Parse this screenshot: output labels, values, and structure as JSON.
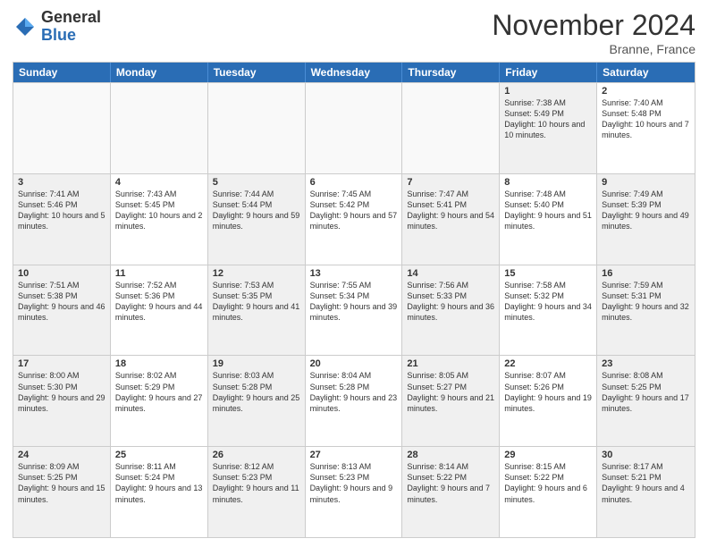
{
  "header": {
    "logo_general": "General",
    "logo_blue": "Blue",
    "title": "November 2024",
    "location": "Branne, France"
  },
  "days_of_week": [
    "Sunday",
    "Monday",
    "Tuesday",
    "Wednesday",
    "Thursday",
    "Friday",
    "Saturday"
  ],
  "weeks": [
    [
      {
        "day": "",
        "info": "",
        "empty": true
      },
      {
        "day": "",
        "info": "",
        "empty": true
      },
      {
        "day": "",
        "info": "",
        "empty": true
      },
      {
        "day": "",
        "info": "",
        "empty": true
      },
      {
        "day": "",
        "info": "",
        "empty": true
      },
      {
        "day": "1",
        "info": "Sunrise: 7:38 AM\nSunset: 5:49 PM\nDaylight: 10 hours and 10 minutes.",
        "shaded": true
      },
      {
        "day": "2",
        "info": "Sunrise: 7:40 AM\nSunset: 5:48 PM\nDaylight: 10 hours and 7 minutes.",
        "shaded": false
      }
    ],
    [
      {
        "day": "3",
        "info": "Sunrise: 7:41 AM\nSunset: 5:46 PM\nDaylight: 10 hours and 5 minutes.",
        "shaded": true
      },
      {
        "day": "4",
        "info": "Sunrise: 7:43 AM\nSunset: 5:45 PM\nDaylight: 10 hours and 2 minutes.",
        "shaded": false
      },
      {
        "day": "5",
        "info": "Sunrise: 7:44 AM\nSunset: 5:44 PM\nDaylight: 9 hours and 59 minutes.",
        "shaded": true
      },
      {
        "day": "6",
        "info": "Sunrise: 7:45 AM\nSunset: 5:42 PM\nDaylight: 9 hours and 57 minutes.",
        "shaded": false
      },
      {
        "day": "7",
        "info": "Sunrise: 7:47 AM\nSunset: 5:41 PM\nDaylight: 9 hours and 54 minutes.",
        "shaded": true
      },
      {
        "day": "8",
        "info": "Sunrise: 7:48 AM\nSunset: 5:40 PM\nDaylight: 9 hours and 51 minutes.",
        "shaded": false
      },
      {
        "day": "9",
        "info": "Sunrise: 7:49 AM\nSunset: 5:39 PM\nDaylight: 9 hours and 49 minutes.",
        "shaded": true
      }
    ],
    [
      {
        "day": "10",
        "info": "Sunrise: 7:51 AM\nSunset: 5:38 PM\nDaylight: 9 hours and 46 minutes.",
        "shaded": true
      },
      {
        "day": "11",
        "info": "Sunrise: 7:52 AM\nSunset: 5:36 PM\nDaylight: 9 hours and 44 minutes.",
        "shaded": false
      },
      {
        "day": "12",
        "info": "Sunrise: 7:53 AM\nSunset: 5:35 PM\nDaylight: 9 hours and 41 minutes.",
        "shaded": true
      },
      {
        "day": "13",
        "info": "Sunrise: 7:55 AM\nSunset: 5:34 PM\nDaylight: 9 hours and 39 minutes.",
        "shaded": false
      },
      {
        "day": "14",
        "info": "Sunrise: 7:56 AM\nSunset: 5:33 PM\nDaylight: 9 hours and 36 minutes.",
        "shaded": true
      },
      {
        "day": "15",
        "info": "Sunrise: 7:58 AM\nSunset: 5:32 PM\nDaylight: 9 hours and 34 minutes.",
        "shaded": false
      },
      {
        "day": "16",
        "info": "Sunrise: 7:59 AM\nSunset: 5:31 PM\nDaylight: 9 hours and 32 minutes.",
        "shaded": true
      }
    ],
    [
      {
        "day": "17",
        "info": "Sunrise: 8:00 AM\nSunset: 5:30 PM\nDaylight: 9 hours and 29 minutes.",
        "shaded": true
      },
      {
        "day": "18",
        "info": "Sunrise: 8:02 AM\nSunset: 5:29 PM\nDaylight: 9 hours and 27 minutes.",
        "shaded": false
      },
      {
        "day": "19",
        "info": "Sunrise: 8:03 AM\nSunset: 5:28 PM\nDaylight: 9 hours and 25 minutes.",
        "shaded": true
      },
      {
        "day": "20",
        "info": "Sunrise: 8:04 AM\nSunset: 5:28 PM\nDaylight: 9 hours and 23 minutes.",
        "shaded": false
      },
      {
        "day": "21",
        "info": "Sunrise: 8:05 AM\nSunset: 5:27 PM\nDaylight: 9 hours and 21 minutes.",
        "shaded": true
      },
      {
        "day": "22",
        "info": "Sunrise: 8:07 AM\nSunset: 5:26 PM\nDaylight: 9 hours and 19 minutes.",
        "shaded": false
      },
      {
        "day": "23",
        "info": "Sunrise: 8:08 AM\nSunset: 5:25 PM\nDaylight: 9 hours and 17 minutes.",
        "shaded": true
      }
    ],
    [
      {
        "day": "24",
        "info": "Sunrise: 8:09 AM\nSunset: 5:25 PM\nDaylight: 9 hours and 15 minutes.",
        "shaded": true
      },
      {
        "day": "25",
        "info": "Sunrise: 8:11 AM\nSunset: 5:24 PM\nDaylight: 9 hours and 13 minutes.",
        "shaded": false
      },
      {
        "day": "26",
        "info": "Sunrise: 8:12 AM\nSunset: 5:23 PM\nDaylight: 9 hours and 11 minutes.",
        "shaded": true
      },
      {
        "day": "27",
        "info": "Sunrise: 8:13 AM\nSunset: 5:23 PM\nDaylight: 9 hours and 9 minutes.",
        "shaded": false
      },
      {
        "day": "28",
        "info": "Sunrise: 8:14 AM\nSunset: 5:22 PM\nDaylight: 9 hours and 7 minutes.",
        "shaded": true
      },
      {
        "day": "29",
        "info": "Sunrise: 8:15 AM\nSunset: 5:22 PM\nDaylight: 9 hours and 6 minutes.",
        "shaded": false
      },
      {
        "day": "30",
        "info": "Sunrise: 8:17 AM\nSunset: 5:21 PM\nDaylight: 9 hours and 4 minutes.",
        "shaded": true
      }
    ]
  ]
}
